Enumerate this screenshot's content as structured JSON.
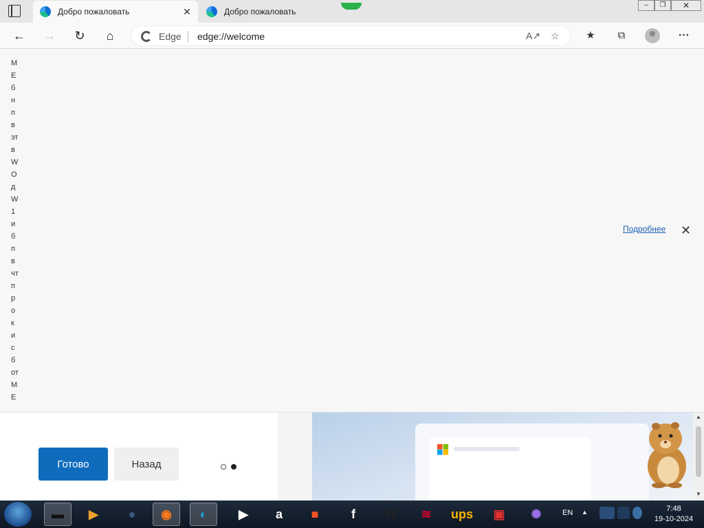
{
  "browser": {
    "tabs": [
      {
        "title": "Добро пожаловать",
        "active": true,
        "close": "✕"
      },
      {
        "title": "Добро пожаловать",
        "active": false
      }
    ],
    "window_controls": {
      "minimize": "–",
      "maximize": "❐",
      "close": "✕"
    }
  },
  "toolbar": {
    "back_icon": "arrow-left-icon",
    "forward_icon": "arrow-right-icon",
    "refresh_icon": "refresh-icon",
    "home_icon": "home-icon",
    "site_label": "Edge",
    "url": "edge://welcome",
    "read_aloud_icon": "read-aloud-icon",
    "add_favorite_icon": "star-plus-icon",
    "favorites_icon": "favorites-icon",
    "collections_icon": "collections-icon",
    "profile_icon": "profile-icon",
    "more_label": "···"
  },
  "page": {
    "vertical_letters": [
      "М",
      "Е",
      "б",
      "н",
      "п",
      "в",
      "эт",
      "в",
      "W",
      "О",
      "д",
      "W",
      "1",
      "и",
      "б",
      "п",
      "в",
      "чт",
      "п",
      "р",
      "о",
      "к",
      "и",
      "с",
      "б",
      "от",
      "М",
      "Е"
    ],
    "learn_more": "Подробнее",
    "dismiss_label": "✕"
  },
  "panel": {
    "done_button": "Готово",
    "back_button": "Назад",
    "carousel": {
      "count": 2,
      "current": 2
    },
    "scroll_up": "▲",
    "scroll_down": "▼"
  },
  "taskbar": {
    "apps": [
      {
        "name": "terminal",
        "glyph": "▬",
        "color": "#111111",
        "active": true
      },
      {
        "name": "media-player",
        "glyph": "▶",
        "color": "#f0a030",
        "active": false
      },
      {
        "name": "ball",
        "glyph": "●",
        "color": "#3a5a80",
        "active": false
      },
      {
        "name": "firefox",
        "glyph": "◉",
        "color": "#ff7a18",
        "active": true
      },
      {
        "name": "edge",
        "glyph": "◐",
        "color": "#1fa2e0",
        "active": true
      },
      {
        "name": "youtube",
        "glyph": "▶",
        "color": "#ffffff",
        "active": false
      },
      {
        "name": "amazon",
        "glyph": "a",
        "color": "#ffffff",
        "active": false
      },
      {
        "name": "windows-store",
        "glyph": "■",
        "color": "#f35325",
        "active": false
      },
      {
        "name": "facebook",
        "glyph": "f",
        "color": "#ffffff",
        "active": false
      },
      {
        "name": "wikipedia",
        "glyph": "W",
        "color": "#222222",
        "active": false
      },
      {
        "name": "bank",
        "glyph": "≋",
        "color": "#d6002a",
        "active": false
      },
      {
        "name": "ups",
        "glyph": "ups",
        "color": "#ffb500",
        "active": false
      },
      {
        "name": "shop",
        "glyph": "▣",
        "color": "#e03030",
        "active": false
      },
      {
        "name": "copilot",
        "glyph": "✺",
        "color": "#9a6ee8",
        "active": false
      }
    ],
    "language": "EN",
    "tray_arrow": "▲",
    "time": "7:48",
    "date": "19-10-2024"
  },
  "colors": {
    "accent": "#0f6cbd",
    "link": "#1a5fb4",
    "taskbar": "#0e1723"
  }
}
